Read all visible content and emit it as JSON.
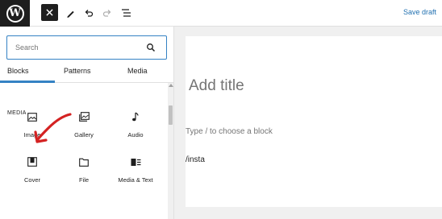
{
  "toolbar": {
    "save_draft_label": "Save draft"
  },
  "inserter": {
    "search_placeholder": "Search",
    "tabs": [
      {
        "label": "Blocks",
        "active": true
      },
      {
        "label": "Patterns",
        "active": false
      },
      {
        "label": "Media",
        "active": false
      }
    ],
    "category": "MEDIA",
    "blocks": [
      {
        "label": "Image",
        "icon": "image-icon"
      },
      {
        "label": "Gallery",
        "icon": "gallery-icon"
      },
      {
        "label": "Audio",
        "icon": "audio-icon"
      },
      {
        "label": "Cover",
        "icon": "cover-icon"
      },
      {
        "label": "File",
        "icon": "file-icon"
      },
      {
        "label": "Media & Text",
        "icon": "media-text-icon"
      }
    ]
  },
  "editor": {
    "title_placeholder": "Add title",
    "block_placeholder": "Type / to choose a block",
    "slash_text": "/insta"
  },
  "colors": {
    "accent": "#3582c4",
    "dark": "#1e1e1e",
    "annotation_arrow": "#d42222"
  }
}
